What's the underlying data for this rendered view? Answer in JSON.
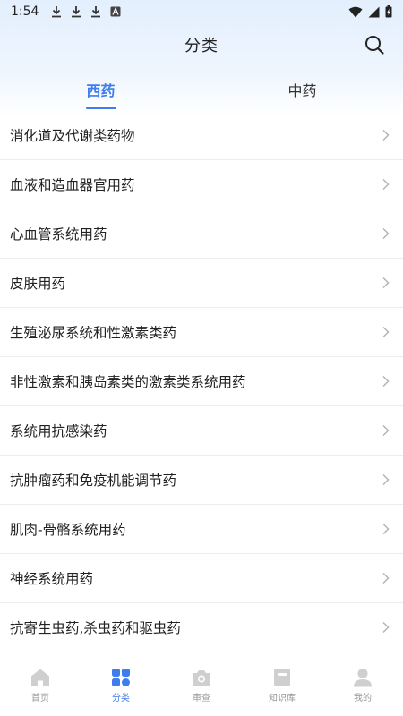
{
  "status_bar": {
    "time": "1:54"
  },
  "header": {
    "title": "分类"
  },
  "tabs": [
    {
      "label": "西药",
      "active": true
    },
    {
      "label": "中药",
      "active": false
    }
  ],
  "categories": [
    {
      "label": "消化道及代谢类药物"
    },
    {
      "label": "血液和造血器官用药"
    },
    {
      "label": "心血管系统用药"
    },
    {
      "label": "皮肤用药"
    },
    {
      "label": "生殖泌尿系统和性激素类药"
    },
    {
      "label": "非性激素和胰岛素类的激素类系统用药"
    },
    {
      "label": "系统用抗感染药"
    },
    {
      "label": "抗肿瘤药和免疫机能调节药"
    },
    {
      "label": "肌肉-骨骼系统用药"
    },
    {
      "label": "神经系统用药"
    },
    {
      "label": "抗寄生虫药,杀虫药和驱虫药"
    }
  ],
  "bottom_nav": [
    {
      "label": "首页",
      "icon": "home-icon",
      "active": false
    },
    {
      "label": "分类",
      "icon": "category-grid-icon",
      "active": true
    },
    {
      "label": "审查",
      "icon": "camera-icon",
      "active": false
    },
    {
      "label": "知识库",
      "icon": "book-icon",
      "active": false
    },
    {
      "label": "我的",
      "icon": "user-icon",
      "active": false
    }
  ],
  "colors": {
    "accent": "#3f7cf0",
    "inactive": "#c8c8c8"
  }
}
